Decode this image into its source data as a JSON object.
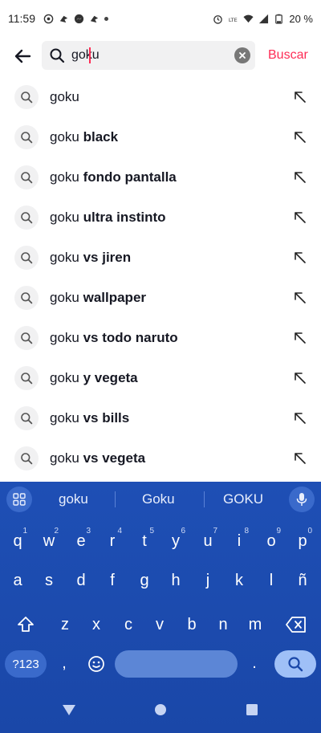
{
  "status_bar": {
    "time": "11:59",
    "battery": "20 %"
  },
  "search": {
    "query": "goku",
    "submit_label": "Buscar"
  },
  "suggestions": [
    {
      "query": "goku",
      "rest": ""
    },
    {
      "query": "goku",
      "rest": " black"
    },
    {
      "query": "goku",
      "rest": " fondo pantalla"
    },
    {
      "query": "goku",
      "rest": " ultra instinto"
    },
    {
      "query": "goku",
      "rest": " vs jiren"
    },
    {
      "query": "goku",
      "rest": " wallpaper"
    },
    {
      "query": "goku",
      "rest": " vs todo naruto"
    },
    {
      "query": "goku",
      "rest": " y vegeta"
    },
    {
      "query": "goku",
      "rest": " vs bills"
    },
    {
      "query": "goku",
      "rest": " vs vegeta"
    }
  ],
  "keyboard": {
    "word_suggestions": [
      "goku",
      "Goku",
      "GOKU"
    ],
    "row1": [
      {
        "k": "q",
        "s": "1"
      },
      {
        "k": "w",
        "s": "2"
      },
      {
        "k": "e",
        "s": "3"
      },
      {
        "k": "r",
        "s": "4"
      },
      {
        "k": "t",
        "s": "5"
      },
      {
        "k": "y",
        "s": "6"
      },
      {
        "k": "u",
        "s": "7"
      },
      {
        "k": "i",
        "s": "8"
      },
      {
        "k": "o",
        "s": "9"
      },
      {
        "k": "p",
        "s": "0"
      }
    ],
    "row2": [
      "a",
      "s",
      "d",
      "f",
      "g",
      "h",
      "j",
      "k",
      "l",
      "ñ"
    ],
    "row3": [
      "z",
      "x",
      "c",
      "v",
      "b",
      "n",
      "m"
    ],
    "symbols_label": "?123",
    "comma": ",",
    "period": "."
  },
  "colors": {
    "accent": "#fe2c55",
    "keyboard_bg": "#1e4fb5",
    "search_bg": "#f1f1f2"
  }
}
